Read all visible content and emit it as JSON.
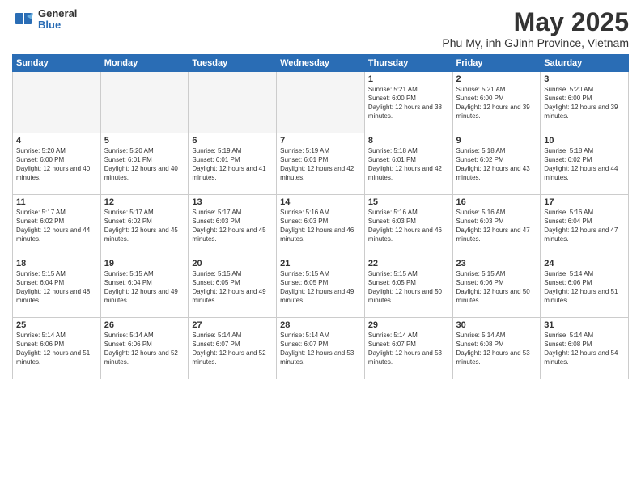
{
  "logo": {
    "general": "General",
    "blue": "Blue"
  },
  "title": "May 2025",
  "subtitle": "Phu My, inh GJinh Province, Vietnam",
  "days_of_week": [
    "Sunday",
    "Monday",
    "Tuesday",
    "Wednesday",
    "Thursday",
    "Friday",
    "Saturday"
  ],
  "weeks": [
    [
      {
        "day": "",
        "empty": true
      },
      {
        "day": "",
        "empty": true
      },
      {
        "day": "",
        "empty": true
      },
      {
        "day": "",
        "empty": true
      },
      {
        "day": "1",
        "sunrise": "5:21 AM",
        "sunset": "6:00 PM",
        "daylight": "12 hours and 38 minutes."
      },
      {
        "day": "2",
        "sunrise": "5:21 AM",
        "sunset": "6:00 PM",
        "daylight": "12 hours and 39 minutes."
      },
      {
        "day": "3",
        "sunrise": "5:20 AM",
        "sunset": "6:00 PM",
        "daylight": "12 hours and 39 minutes."
      }
    ],
    [
      {
        "day": "4",
        "sunrise": "5:20 AM",
        "sunset": "6:00 PM",
        "daylight": "12 hours and 40 minutes."
      },
      {
        "day": "5",
        "sunrise": "5:20 AM",
        "sunset": "6:01 PM",
        "daylight": "12 hours and 40 minutes."
      },
      {
        "day": "6",
        "sunrise": "5:19 AM",
        "sunset": "6:01 PM",
        "daylight": "12 hours and 41 minutes."
      },
      {
        "day": "7",
        "sunrise": "5:19 AM",
        "sunset": "6:01 PM",
        "daylight": "12 hours and 42 minutes."
      },
      {
        "day": "8",
        "sunrise": "5:18 AM",
        "sunset": "6:01 PM",
        "daylight": "12 hours and 42 minutes."
      },
      {
        "day": "9",
        "sunrise": "5:18 AM",
        "sunset": "6:02 PM",
        "daylight": "12 hours and 43 minutes."
      },
      {
        "day": "10",
        "sunrise": "5:18 AM",
        "sunset": "6:02 PM",
        "daylight": "12 hours and 44 minutes."
      }
    ],
    [
      {
        "day": "11",
        "sunrise": "5:17 AM",
        "sunset": "6:02 PM",
        "daylight": "12 hours and 44 minutes."
      },
      {
        "day": "12",
        "sunrise": "5:17 AM",
        "sunset": "6:02 PM",
        "daylight": "12 hours and 45 minutes."
      },
      {
        "day": "13",
        "sunrise": "5:17 AM",
        "sunset": "6:03 PM",
        "daylight": "12 hours and 45 minutes."
      },
      {
        "day": "14",
        "sunrise": "5:16 AM",
        "sunset": "6:03 PM",
        "daylight": "12 hours and 46 minutes."
      },
      {
        "day": "15",
        "sunrise": "5:16 AM",
        "sunset": "6:03 PM",
        "daylight": "12 hours and 46 minutes."
      },
      {
        "day": "16",
        "sunrise": "5:16 AM",
        "sunset": "6:03 PM",
        "daylight": "12 hours and 47 minutes."
      },
      {
        "day": "17",
        "sunrise": "5:16 AM",
        "sunset": "6:04 PM",
        "daylight": "12 hours and 47 minutes."
      }
    ],
    [
      {
        "day": "18",
        "sunrise": "5:15 AM",
        "sunset": "6:04 PM",
        "daylight": "12 hours and 48 minutes."
      },
      {
        "day": "19",
        "sunrise": "5:15 AM",
        "sunset": "6:04 PM",
        "daylight": "12 hours and 49 minutes."
      },
      {
        "day": "20",
        "sunrise": "5:15 AM",
        "sunset": "6:05 PM",
        "daylight": "12 hours and 49 minutes."
      },
      {
        "day": "21",
        "sunrise": "5:15 AM",
        "sunset": "6:05 PM",
        "daylight": "12 hours and 49 minutes."
      },
      {
        "day": "22",
        "sunrise": "5:15 AM",
        "sunset": "6:05 PM",
        "daylight": "12 hours and 50 minutes."
      },
      {
        "day": "23",
        "sunrise": "5:15 AM",
        "sunset": "6:06 PM",
        "daylight": "12 hours and 50 minutes."
      },
      {
        "day": "24",
        "sunrise": "5:14 AM",
        "sunset": "6:06 PM",
        "daylight": "12 hours and 51 minutes."
      }
    ],
    [
      {
        "day": "25",
        "sunrise": "5:14 AM",
        "sunset": "6:06 PM",
        "daylight": "12 hours and 51 minutes."
      },
      {
        "day": "26",
        "sunrise": "5:14 AM",
        "sunset": "6:06 PM",
        "daylight": "12 hours and 52 minutes."
      },
      {
        "day": "27",
        "sunrise": "5:14 AM",
        "sunset": "6:07 PM",
        "daylight": "12 hours and 52 minutes."
      },
      {
        "day": "28",
        "sunrise": "5:14 AM",
        "sunset": "6:07 PM",
        "daylight": "12 hours and 53 minutes."
      },
      {
        "day": "29",
        "sunrise": "5:14 AM",
        "sunset": "6:07 PM",
        "daylight": "12 hours and 53 minutes."
      },
      {
        "day": "30",
        "sunrise": "5:14 AM",
        "sunset": "6:08 PM",
        "daylight": "12 hours and 53 minutes."
      },
      {
        "day": "31",
        "sunrise": "5:14 AM",
        "sunset": "6:08 PM",
        "daylight": "12 hours and 54 minutes."
      }
    ]
  ]
}
